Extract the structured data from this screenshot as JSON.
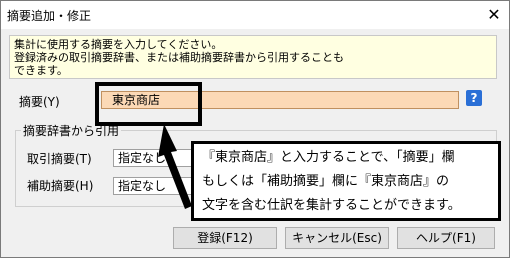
{
  "window": {
    "title": "摘要追加・修正",
    "close_glyph": "✕"
  },
  "info": {
    "lines": [
      "集計に使用する摘要を入力してください。",
      "登録済みの取引摘要辞書、または補助摘要辞書から引用することも",
      "できます。"
    ]
  },
  "summary": {
    "label": "摘要(Y)",
    "value": "東京商店",
    "help_glyph": "?"
  },
  "dictionary": {
    "group_label": "摘要辞書から引用",
    "torihiki": {
      "label": "取引摘要(T)",
      "value": "指定なし"
    },
    "hojo": {
      "label": "補助摘要(H)",
      "value": "指定なし"
    }
  },
  "buttons": {
    "register": "登録(F12)",
    "cancel": "キャンセル(Esc)",
    "help": "ヘルプ(F1)"
  },
  "callout": {
    "lines": [
      "『東京商店』と入力することで、「摘要」欄",
      "もしくは「補助摘要」欄に『東京商店』の",
      "文字を含む仕訳を集計することができます。"
    ]
  }
}
